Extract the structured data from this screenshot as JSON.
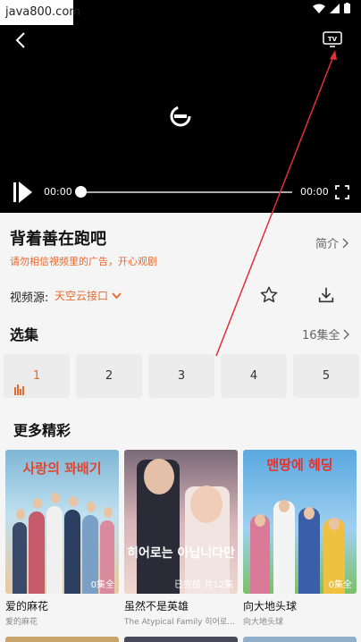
{
  "watermark": "java800.com",
  "player": {
    "time_current": "00:00",
    "time_total": "00:00",
    "progress": 0
  },
  "video": {
    "title": "背着善在跑吧",
    "notice": "请勿相信视频里的广告，开心观剧",
    "intro_label": "简介",
    "source_label": "视频源:",
    "source_value": "天空云接口"
  },
  "episodes": {
    "section_title": "选集",
    "count_label": "16集全",
    "items": [
      "1",
      "2",
      "3",
      "4",
      "5"
    ],
    "active_index": 0
  },
  "more": {
    "section_title": "更多精彩",
    "cards": [
      {
        "name": "爱的麻花",
        "sub": "爱的麻花",
        "badge": "0集全",
        "poster_text": "사랑의 꽈배기"
      },
      {
        "name": "虽然不是英雄",
        "sub": "The Atypical Family 히어로...",
        "badge": "已完结 共12集",
        "poster_text": "히어로는 아닙니다만"
      },
      {
        "name": "向大地头球",
        "sub": "向大地头球",
        "badge": "0集全",
        "poster_text": "맨땅에 헤딩"
      }
    ]
  },
  "colors": {
    "accent": "#e8692e",
    "annotation_arrow": "#e0303a"
  }
}
